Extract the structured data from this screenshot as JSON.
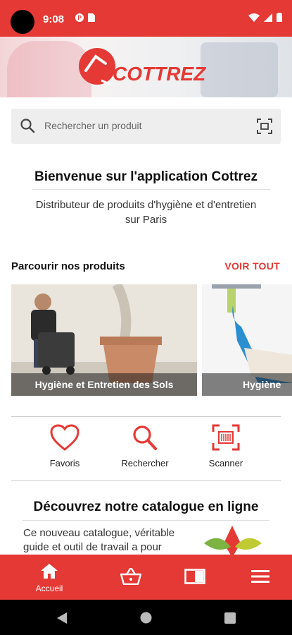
{
  "status_bar": {
    "time": "9:08"
  },
  "header": {
    "brand": "COTTREZ"
  },
  "search": {
    "placeholder": "Rechercher un produit"
  },
  "welcome": {
    "title": "Bienvenue sur l'application Cottrez",
    "subtitle": "Distributeur de produits d'hygiène et d'entretien sur Paris"
  },
  "browse": {
    "title": "Parcourir nos produits",
    "see_all": "VOIR TOUT",
    "cards": [
      {
        "label": "Hygiène et Entretien des Sols"
      },
      {
        "label": "Hygiène"
      }
    ]
  },
  "actions": [
    {
      "label": "Favoris",
      "icon": "heart-icon"
    },
    {
      "label": "Rechercher",
      "icon": "search-icon"
    },
    {
      "label": "Scanner",
      "icon": "barcode-scan-icon"
    }
  ],
  "catalogue": {
    "title": "Découvrez notre catalogue en ligne",
    "text": "Ce nouveau catalogue, véritable guide et outil de travail a pour"
  },
  "bottom_nav": [
    {
      "label": "Accueil",
      "icon": "home-icon",
      "active": true
    },
    {
      "label": "",
      "icon": "basket-icon"
    },
    {
      "label": "",
      "icon": "catalogue-icon"
    },
    {
      "label": "",
      "icon": "menu-icon"
    }
  ],
  "colors": {
    "accent": "#e53935",
    "dark": "#000000"
  }
}
